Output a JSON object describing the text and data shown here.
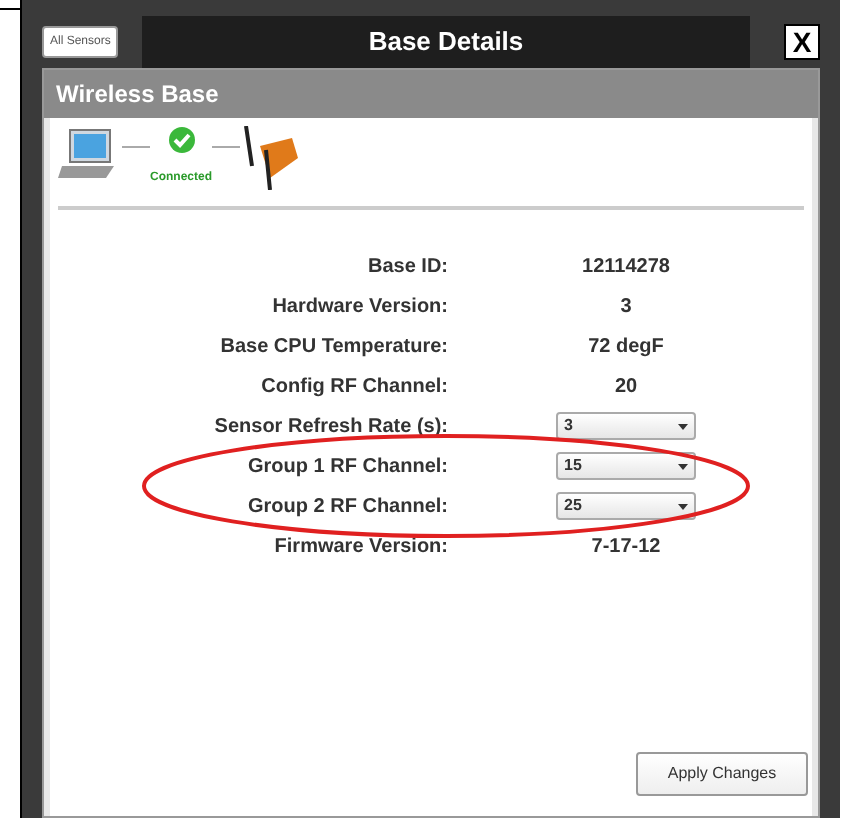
{
  "window": {
    "title": "Base Details",
    "back_button": "All Sensors",
    "close": "X"
  },
  "panel": {
    "title": "Wireless Base",
    "status": "Connected"
  },
  "fields": [
    {
      "label": "Base ID:",
      "kind": "text",
      "value": "12114278"
    },
    {
      "label": "Hardware Version:",
      "kind": "text",
      "value": "3"
    },
    {
      "label": "Base CPU Temperature:",
      "kind": "text",
      "value": "72 degF"
    },
    {
      "label": "Config RF Channel:",
      "kind": "text",
      "value": "20"
    },
    {
      "label": "Sensor Refresh Rate (s):",
      "kind": "select",
      "value": "3"
    },
    {
      "label": "Group 1 RF Channel:",
      "kind": "select",
      "value": "15"
    },
    {
      "label": "Group 2 RF Channel:",
      "kind": "select",
      "value": "25"
    },
    {
      "label": "Firmware Version:",
      "kind": "text",
      "value": "7-17-12"
    }
  ],
  "apply_button": "Apply Changes"
}
